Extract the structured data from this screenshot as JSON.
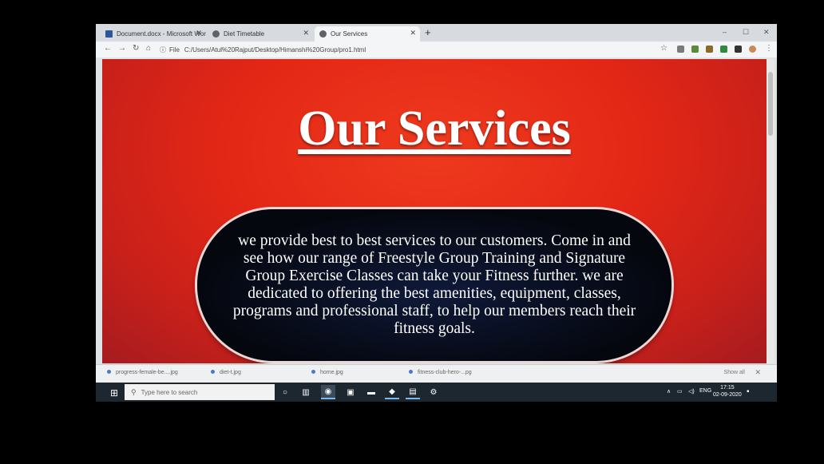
{
  "tabs": [
    {
      "title": "Document.docx - Microsoft Wor",
      "close": "✕",
      "color": "#2b579a"
    },
    {
      "title": "Diet Timetable",
      "close": "✕",
      "color": "#5f6368"
    },
    {
      "title": "Our Services",
      "close": "✕",
      "color": "#5f6368"
    }
  ],
  "new_tab": "+",
  "window_controls": {
    "minimize": "–",
    "maximize": "☐",
    "close": "✕"
  },
  "nav": {
    "back": "←",
    "forward": "→",
    "reload": "↻",
    "home": "⌂"
  },
  "address": {
    "info": "ⓘ",
    "scheme_label": "File",
    "url": "C:/Users/Atul%20Rajput/Desktop/Himanshi%20Group/pro1.html"
  },
  "toolbar_icons": {
    "star": "☆"
  },
  "page": {
    "title": "Our Services",
    "description": "we provide best to best services to our customers. Come in and see how our range of Freestyle Group Training and Signature Group Exercise Classes can take your Fitness further. we are dedicated to offering the best amenities, equipment, classes, programs and professional staff, to help our members reach their fitness goals."
  },
  "downloads": {
    "items": [
      "progress-female-be....jpg",
      "diet-t.jpg",
      "home.jpg",
      "fitness-club-hero-...pg"
    ],
    "show_all": "Show all",
    "close": "✕"
  },
  "taskbar": {
    "start": "⊞",
    "search_icon": "⚲",
    "search_placeholder": "Type here to search",
    "tray_language": "ENG",
    "time": "17:15",
    "date": "02-09-2020"
  },
  "colors": {
    "page_bg": "#e32716",
    "pill_bg": "#05070f",
    "taskbar_bg": "#1d2730"
  }
}
